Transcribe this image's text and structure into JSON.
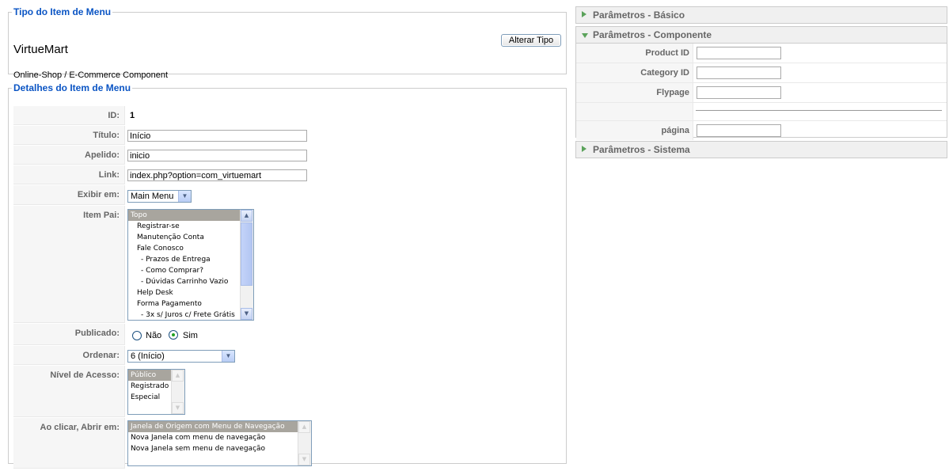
{
  "type_section": {
    "legend": "Tipo do Item de Menu",
    "component_name": "VirtueMart",
    "component_desc": "Online-Shop / E-Commerce Component",
    "change_button": "Alterar Tipo"
  },
  "details": {
    "legend": "Detalhes do Item de Menu",
    "id_label": "ID:",
    "id_value": "1",
    "title_label": "Título:",
    "title_value": "Início",
    "alias_label": "Apelido:",
    "alias_value": "inicio",
    "link_label": "Link:",
    "link_value": "index.php?option=com_virtuemart",
    "menu_label": "Exibir em:",
    "menu_value": "Main Menu",
    "parent_label": "Item Pai:",
    "parent_items": [
      "Topo",
      "Registrar-se",
      "Manutenção Conta",
      "Fale Conosco",
      "- Prazos de Entrega",
      "- Como Comprar?",
      "- Dúvidas Carrinho Vazio",
      "Help Desk",
      "Forma Pagamento",
      "- 3x s/ Juros c/ Frete Grátis"
    ],
    "published_label": "Publicado:",
    "published_no": "Não",
    "published_yes": "Sim",
    "order_label": "Ordenar:",
    "order_value": "6 (Início)",
    "access_label": "Nível de Acesso:",
    "access_items": [
      "Público",
      "Registrado",
      "Especial"
    ],
    "onclick_label": "Ao clicar, Abrir em:",
    "onclick_items": [
      "Janela de Origem com Menu de Navegação",
      "Nova Janela com menu de navegação",
      "Nova Janela sem menu de navegação"
    ]
  },
  "params": {
    "basic_title": "Parâmetros - Básico",
    "component_title": "Parâmetros - Componente",
    "product_id_label": "Product ID",
    "category_id_label": "Category ID",
    "flypage_label": "Flypage",
    "page_label": "página",
    "system_title": "Parâmetros - Sistema"
  },
  "colors": {
    "legend": "#0b55c4",
    "selected_option": "#a8a59e",
    "panel_arrow": "#5aa25a"
  }
}
